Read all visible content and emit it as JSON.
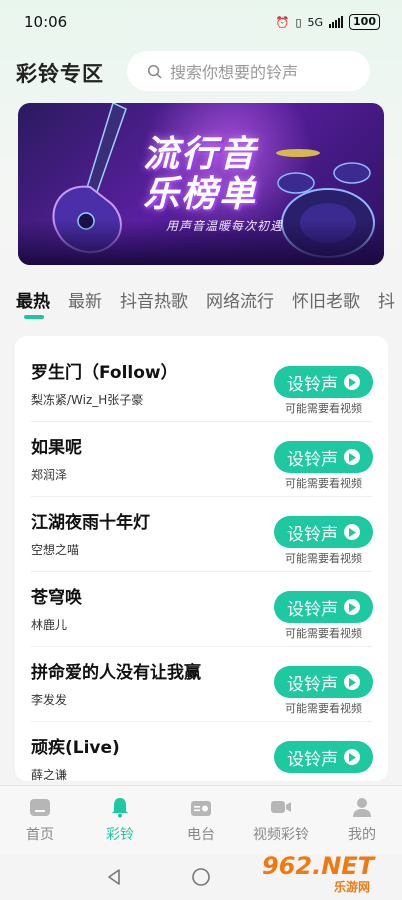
{
  "status": {
    "time": "10:06",
    "network": "5G",
    "battery": "100"
  },
  "header": {
    "title": "彩铃专区",
    "search_placeholder": "搜索你想要的铃声"
  },
  "banner": {
    "title_line1": "流行音",
    "title_line2": "乐榜单",
    "subtitle": "用声音温暖每次初遇"
  },
  "tabs": [
    "最热",
    "最新",
    "抖音热歌",
    "网络流行",
    "怀旧老歌",
    "抖"
  ],
  "songs": [
    {
      "name": "罗生门（Follow）",
      "artist": "梨冻紧/Wiz_H张子豪"
    },
    {
      "name": "如果呢",
      "artist": "郑润泽"
    },
    {
      "name": "江湖夜雨十年灯",
      "artist": "空想之喵"
    },
    {
      "name": "苍穹唤",
      "artist": "林鹿儿"
    },
    {
      "name": "拼命爱的人没有让我赢",
      "artist": "李发发"
    },
    {
      "name": "顽疾(Live)",
      "artist": "薛之谦"
    }
  ],
  "song_button_label": "设铃声",
  "song_button_hint": "可能需要看视频",
  "nav": [
    "首页",
    "彩铃",
    "电台",
    "视频彩铃",
    "我的"
  ],
  "watermark": {
    "brand": "962.NET",
    "sub": "乐游网"
  },
  "colors": {
    "accent": "#1ec8a0"
  }
}
